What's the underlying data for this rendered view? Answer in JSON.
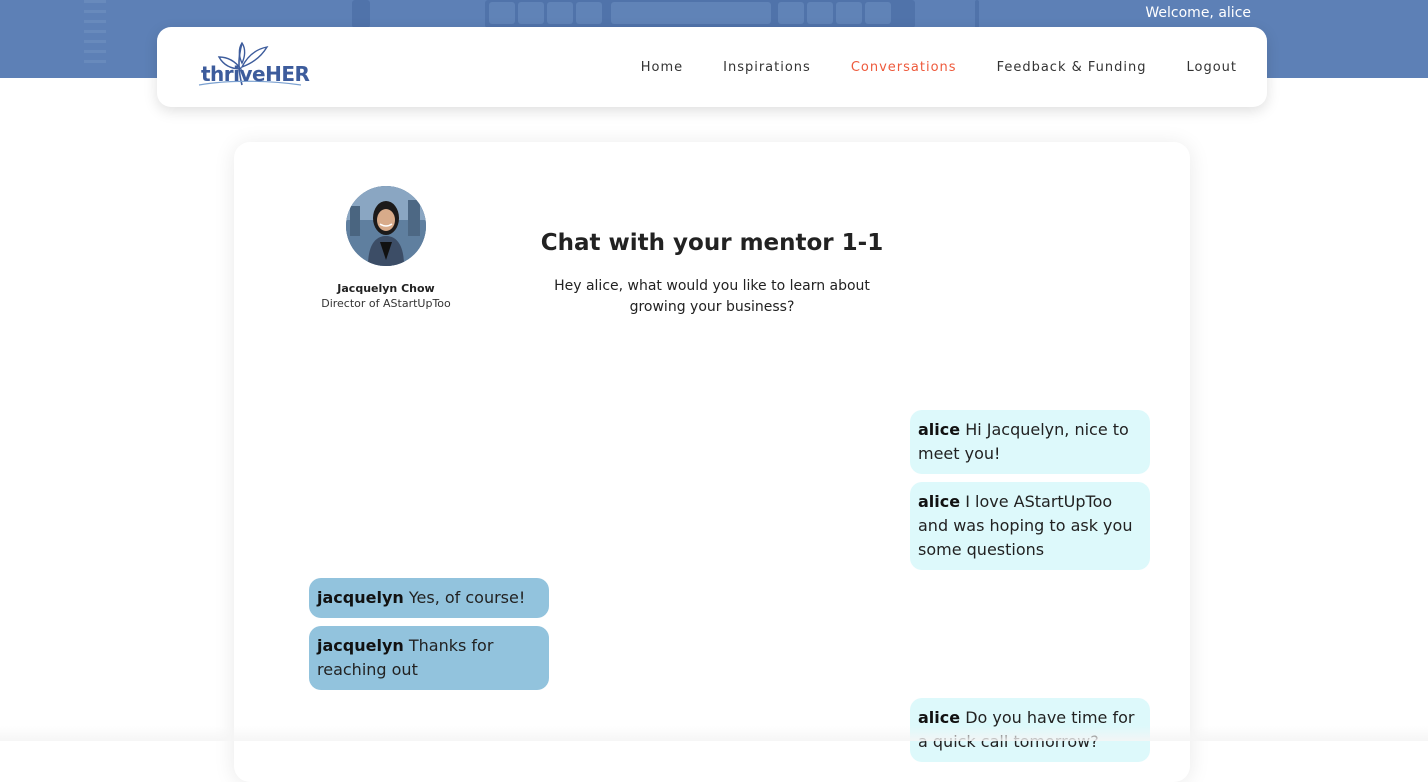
{
  "header": {
    "welcome": "Welcome, alice",
    "logo_text": "thriveHER",
    "nav": [
      {
        "label": "Home",
        "active": false
      },
      {
        "label": "Inspirations",
        "active": false
      },
      {
        "label": "Conversations",
        "active": true
      },
      {
        "label": "Feedback & Funding",
        "active": false
      },
      {
        "label": "Logout",
        "active": false
      }
    ]
  },
  "mentor": {
    "name": "Jacquelyn Chow",
    "role": "Director of AStartUpToo"
  },
  "chat": {
    "title": "Chat with your mentor 1-1",
    "subtitle": "Hey alice, what would you like to learn about growing your business?",
    "messages": [
      {
        "sender": "alice",
        "text": "Hi Jacquelyn, nice to meet you!",
        "side": "right"
      },
      {
        "sender": "alice",
        "text": "I love AStartUpToo and was hoping to ask you some questions",
        "side": "right"
      },
      {
        "sender": "jacquelyn",
        "text": "Yes, of course!",
        "side": "left"
      },
      {
        "sender": "jacquelyn",
        "text": "Thanks for reaching out",
        "side": "left"
      },
      {
        "sender": "alice",
        "text": "Do you have time for a quick call tomorrow?",
        "side": "right"
      }
    ]
  },
  "colors": {
    "accent": "#ee5a3c",
    "hero": "#5d80b6",
    "my_bubble": "#ddf9fb",
    "their_bubble": "#92c3dd",
    "logo": "#3d5c9c"
  }
}
